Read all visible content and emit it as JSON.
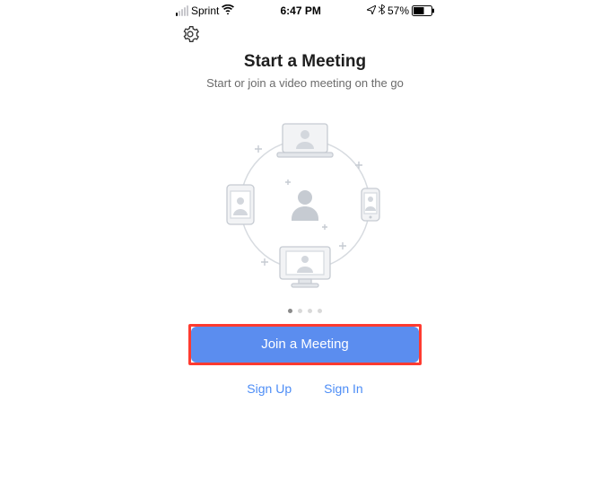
{
  "status_bar": {
    "carrier": "Sprint",
    "time": "6:47 PM",
    "battery_pct": "57%"
  },
  "title": "Start a Meeting",
  "subtitle": "Start or join a video meeting on the go",
  "page_dots": {
    "count": 4,
    "active_index": 0
  },
  "cta_label": "Join a Meeting",
  "secondary_links": {
    "sign_up": "Sign Up",
    "sign_in": "Sign In"
  }
}
